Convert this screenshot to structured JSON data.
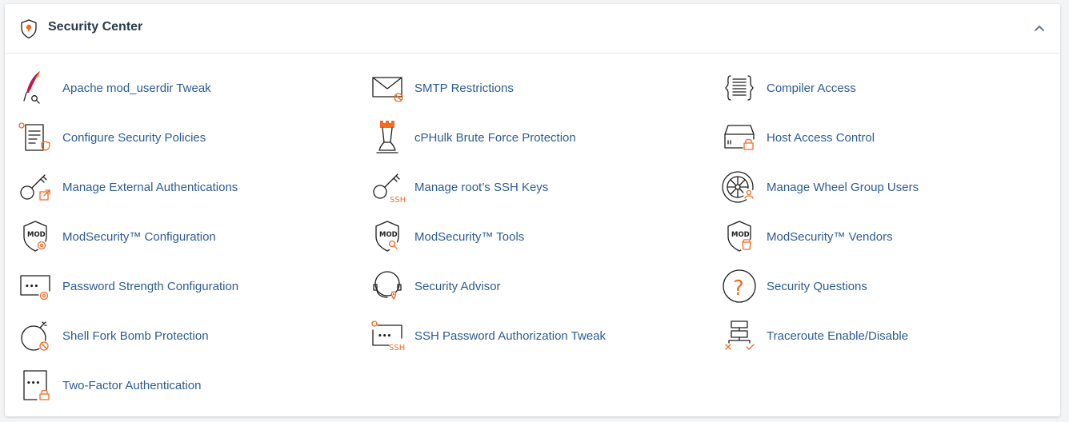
{
  "panel": {
    "title": "Security Center",
    "header_icon": "shield-icon",
    "collapse_icon": "chevron-up-icon"
  },
  "items": [
    {
      "label": "Apache mod_userdir Tweak",
      "icon": "apache-feather-icon"
    },
    {
      "label": "SMTP Restrictions",
      "icon": "smtp-envelope-icon"
    },
    {
      "label": "Compiler Access",
      "icon": "compiler-icon"
    },
    {
      "label": "Configure Security Policies",
      "icon": "security-policy-icon"
    },
    {
      "label": "cPHulk Brute Force Protection",
      "icon": "chess-rook-icon"
    },
    {
      "label": "Host Access Control",
      "icon": "host-lock-icon"
    },
    {
      "label": "Manage External Authentications",
      "icon": "external-key-icon"
    },
    {
      "label": "Manage root’s SSH Keys",
      "icon": "ssh-key-icon"
    },
    {
      "label": "Manage Wheel Group Users",
      "icon": "wheel-users-icon"
    },
    {
      "label": "ModSecurity™ Configuration",
      "icon": "modsecurity-gear-icon"
    },
    {
      "label": "ModSecurity™ Tools",
      "icon": "modsecurity-tools-icon"
    },
    {
      "label": "ModSecurity™ Vendors",
      "icon": "modsecurity-vendors-icon"
    },
    {
      "label": "Password Strength Configuration",
      "icon": "password-gear-icon"
    },
    {
      "label": "Security Advisor",
      "icon": "security-advisor-icon"
    },
    {
      "label": "Security Questions",
      "icon": "question-icon"
    },
    {
      "label": "Shell Fork Bomb Protection",
      "icon": "fork-bomb-icon"
    },
    {
      "label": "SSH Password Authorization Tweak",
      "icon": "ssh-password-icon"
    },
    {
      "label": "Traceroute Enable/Disable",
      "icon": "traceroute-icon"
    },
    {
      "label": "Two-Factor Authentication",
      "icon": "two-factor-icon"
    }
  ],
  "icon_text": {
    "mod": "MOD",
    "ssh": "SSH",
    "dots": "•••",
    "question_mark": "?"
  },
  "colors": {
    "link": "#2c5c94",
    "accent": "#f26b21",
    "title": "#293a4a"
  }
}
